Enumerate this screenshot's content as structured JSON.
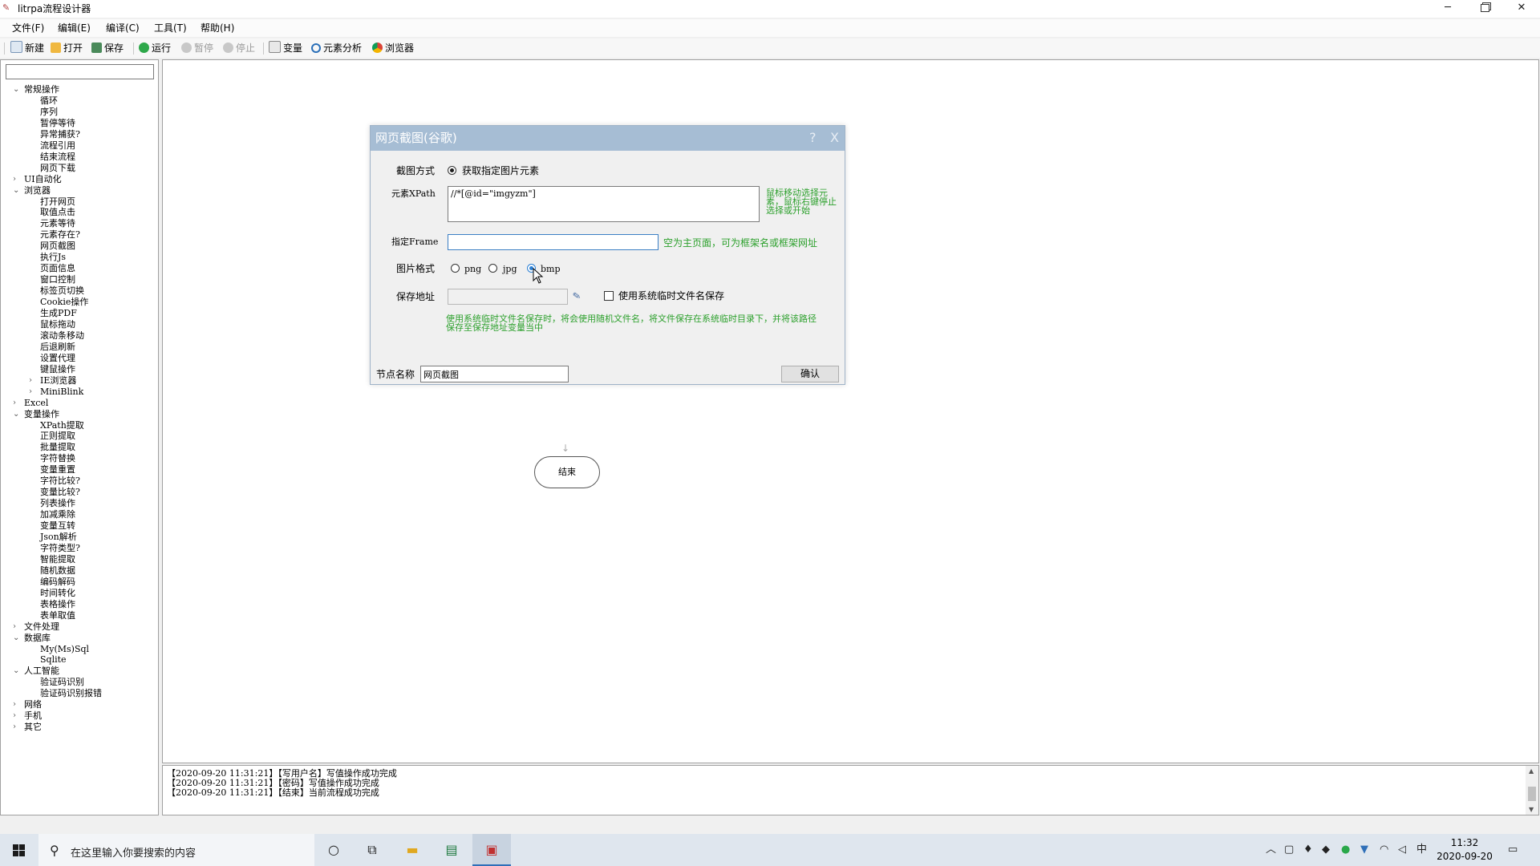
{
  "window": {
    "title": "litrpa流程设计器",
    "minimize": "─",
    "close": "✕"
  },
  "menu": [
    "文件(F)",
    "编辑(E)",
    "编译(C)",
    "工具(T)",
    "帮助(H)"
  ],
  "toolbar": {
    "new": "新建",
    "open": "打开",
    "save": "保存",
    "run": "运行",
    "pause": "暂停",
    "stop": "停止",
    "variables": "变量",
    "element_analysis": "元素分析",
    "browser": "浏览器"
  },
  "tree": [
    {
      "label": "常规操作",
      "level": 0,
      "expanded": true
    },
    {
      "label": "循环",
      "level": 1
    },
    {
      "label": "序列",
      "level": 1
    },
    {
      "label": "暂停等待",
      "level": 1
    },
    {
      "label": "异常捕获?",
      "level": 1
    },
    {
      "label": "流程引用",
      "level": 1
    },
    {
      "label": "结束流程",
      "level": 1
    },
    {
      "label": "网页下载",
      "level": 1
    },
    {
      "label": "UI自动化",
      "level": 0,
      "expanded": false
    },
    {
      "label": "浏览器",
      "level": 0,
      "expanded": true
    },
    {
      "label": "打开网页",
      "level": 1
    },
    {
      "label": "取值点击",
      "level": 1
    },
    {
      "label": "元素等待",
      "level": 1
    },
    {
      "label": "元素存在?",
      "level": 1
    },
    {
      "label": "网页截图",
      "level": 1
    },
    {
      "label": "执行Js",
      "level": 1
    },
    {
      "label": "页面信息",
      "level": 1
    },
    {
      "label": "窗口控制",
      "level": 1
    },
    {
      "label": "标签页切换",
      "level": 1
    },
    {
      "label": "Cookie操作",
      "level": 1
    },
    {
      "label": "生成PDF",
      "level": 1
    },
    {
      "label": "鼠标拖动",
      "level": 1
    },
    {
      "label": "滚动条移动",
      "level": 1
    },
    {
      "label": "后退刷新",
      "level": 1
    },
    {
      "label": "设置代理",
      "level": 1
    },
    {
      "label": "键鼠操作",
      "level": 1
    },
    {
      "label": "IE浏览器",
      "level": 1,
      "expanded": false
    },
    {
      "label": "MiniBlink",
      "level": 1,
      "expanded": false
    },
    {
      "label": "Excel",
      "level": 0,
      "expanded": false
    },
    {
      "label": "变量操作",
      "level": 0,
      "expanded": true
    },
    {
      "label": "XPath提取",
      "level": 1
    },
    {
      "label": "正则提取",
      "level": 1
    },
    {
      "label": "批量提取",
      "level": 1
    },
    {
      "label": "字符替换",
      "level": 1
    },
    {
      "label": "变量重置",
      "level": 1
    },
    {
      "label": "字符比较?",
      "level": 1
    },
    {
      "label": "变量比较?",
      "level": 1
    },
    {
      "label": "列表操作",
      "level": 1
    },
    {
      "label": "加减乘除",
      "level": 1
    },
    {
      "label": "变量互转",
      "level": 1
    },
    {
      "label": "Json解析",
      "level": 1
    },
    {
      "label": "字符类型?",
      "level": 1
    },
    {
      "label": "智能提取",
      "level": 1
    },
    {
      "label": "随机数据",
      "level": 1
    },
    {
      "label": "编码解码",
      "level": 1
    },
    {
      "label": "时间转化",
      "level": 1
    },
    {
      "label": "表格操作",
      "level": 1
    },
    {
      "label": "表单取值",
      "level": 1
    },
    {
      "label": "文件处理",
      "level": 0,
      "expanded": false
    },
    {
      "label": "数据库",
      "level": 0,
      "expanded": true
    },
    {
      "label": "My(Ms)Sql",
      "level": 1
    },
    {
      "label": "Sqlite",
      "level": 1
    },
    {
      "label": "人工智能",
      "level": 0,
      "expanded": true
    },
    {
      "label": "验证码识别",
      "level": 1
    },
    {
      "label": "验证码识别报错",
      "level": 1
    },
    {
      "label": "网络",
      "level": 0,
      "expanded": false
    },
    {
      "label": "手机",
      "level": 0,
      "expanded": false
    },
    {
      "label": "其它",
      "level": 0,
      "expanded": false
    }
  ],
  "canvas": {
    "end_node": "结束"
  },
  "dialog": {
    "title": "网页截图(谷歌)",
    "help": "?",
    "close": "X",
    "capture_mode_label": "截图方式",
    "capture_mode_option": "获取指定图片元素",
    "xpath_label": "元素XPath",
    "xpath_value": "//*[@id=\"imgyzm\"]",
    "xpath_hint": "鼠标移动选择元素，鼠标右键停止选择或开始",
    "frame_label": "指定Frame",
    "frame_value": "",
    "frame_hint": "空为主页面，可为框架名或框架网址",
    "format_label": "图片格式",
    "format_options": [
      "png",
      "jpg",
      "bmp"
    ],
    "format_selected": "bmp",
    "save_label": "保存地址",
    "save_value": "",
    "use_temp_label": "使用系统临时文件名保存",
    "use_temp_checked": false,
    "temp_hint": "使用系统临时文件名保存时，将会使用随机文件名，将文件保存在系统临时目录下，并将该路径保存至保存地址变量当中",
    "node_name_label": "节点名称",
    "node_name_value": "网页截图",
    "confirm": "确认"
  },
  "log": [
    "【2020-09-20 11:31:21】【写用户名】写值操作成功完成",
    "【2020-09-20 11:31:21】【密码】写值操作成功完成",
    "【2020-09-20 11:31:21】【结束】当前流程成功完成"
  ],
  "taskbar": {
    "search_placeholder": "在这里输入你要搜索的内容",
    "ime": "中",
    "time": "11:32",
    "date": "2020-09-20"
  },
  "colors": {
    "dialog_header": "#a6bdd4",
    "hint_green": "#2ca02c",
    "accent_blue": "#2f6fb8"
  }
}
